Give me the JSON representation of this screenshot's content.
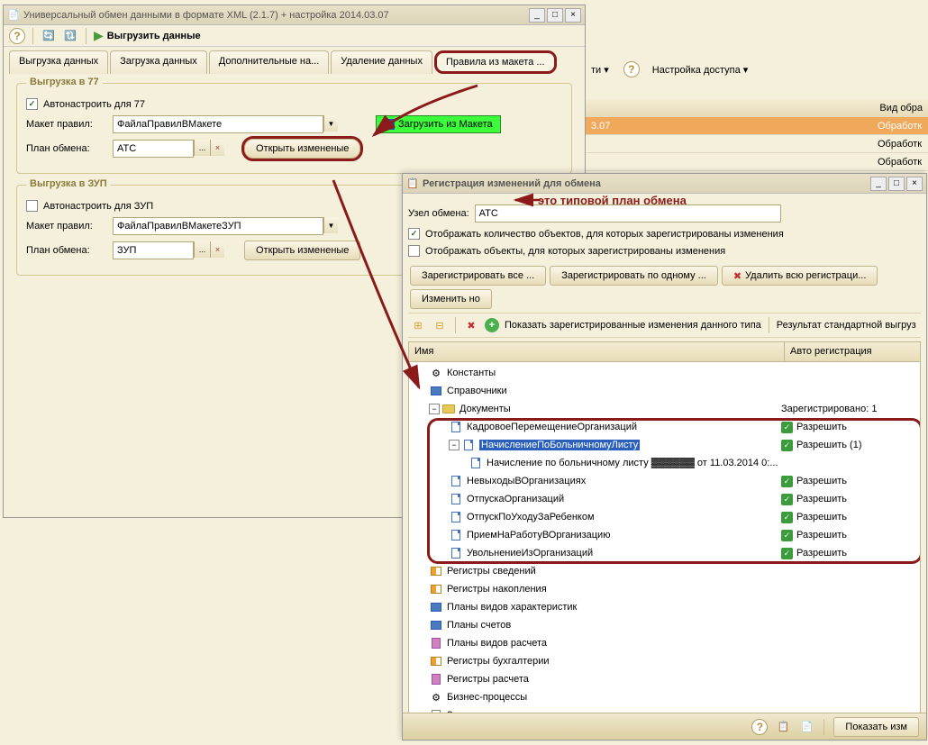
{
  "window1": {
    "title": "Универсальный обмен данными в формате XML (2.1.7) + настройка 2014.03.07",
    "toolbar_action": "Выгрузить данные",
    "tabs": [
      "Выгрузка данных",
      "Загрузка данных",
      "Дополнительные на...",
      "Удаление данных",
      "Правила из макета ..."
    ],
    "group77": {
      "title": "Выгрузка в 77",
      "autotune": "Автонастроить для 77",
      "maket_label": "Макет правил:",
      "maket_value": "ФайлаПравилВМакете",
      "plan_label": "План обмена:",
      "plan_value": "АТС",
      "open_btn": "Открыть измененые",
      "load_btn": "Загрузить из Макета"
    },
    "groupZUP": {
      "title": "Выгрузка в ЗУП",
      "autotune": "Автонастроить для ЗУП",
      "maket_label": "Макет правил:",
      "maket_value": "ФайлаПравилВМакетеЗУП",
      "plan_label": "План обмена:",
      "plan_value": "ЗУП",
      "open_btn": "Открыть измененые"
    }
  },
  "bg": {
    "tab_suffix": "ти ▾",
    "help": "?",
    "access": "Настройка доступа ▾",
    "header_col": "Вид обра",
    "row1": "3.07",
    "col2_text": "Обработк"
  },
  "window2": {
    "title": "Регистрация изменений для обмена",
    "node_label": "Узел обмена:",
    "node_value": "АТС",
    "annotation": "это типовой план обмена",
    "chk1": "Отображать количество объектов, для которых зарегистрированы изменения",
    "chk2": "Отображать объекты, для которых зарегистрированы изменения",
    "btns": [
      "Зарегистрировать все ...",
      "Зарегистрировать по одному ...",
      "Удалить всю регистраци...",
      "Изменить но"
    ],
    "tb3_link1": "Показать зарегистрированные изменения данного типа",
    "tb3_link2": "Результат стандартной выгруз",
    "tree_header": [
      "Имя",
      "Авто регистрация"
    ],
    "tree": [
      {
        "l": 0,
        "icon": "gear",
        "label": "Константы",
        "col2": ""
      },
      {
        "l": 0,
        "icon": "book",
        "label": "Справочники",
        "col2": ""
      },
      {
        "l": 0,
        "icon": "folder",
        "label": "Документы",
        "col2": "Зарегистрировано: 1",
        "exp": "open"
      },
      {
        "l": 1,
        "icon": "doc",
        "label": "КадровоеПеремещениеОрганизаций",
        "col2": "Разрешить",
        "allow": true
      },
      {
        "l": 1,
        "icon": "doc",
        "label": "НачислениеПоБольничномуЛисту",
        "col2": "Разрешить (1)",
        "allow": true,
        "selected": true,
        "exp": "minus"
      },
      {
        "l": 2,
        "icon": "doc",
        "label": "Начисление по больничному листу ▓▓▓▓▓▓ от 11.03.2014 0:...",
        "col2": ""
      },
      {
        "l": 1,
        "icon": "doc",
        "label": "НевыходыВОрганизациях",
        "col2": "Разрешить",
        "allow": true
      },
      {
        "l": 1,
        "icon": "doc",
        "label": "ОтпускаОрганизаций",
        "col2": "Разрешить",
        "allow": true
      },
      {
        "l": 1,
        "icon": "doc",
        "label": "ОтпускПоУходуЗаРебенком",
        "col2": "Разрешить",
        "allow": true
      },
      {
        "l": 1,
        "icon": "doc",
        "label": "ПриемНаРаботуВОрганизацию",
        "col2": "Разрешить",
        "allow": true
      },
      {
        "l": 1,
        "icon": "doc",
        "label": "УвольнениеИзОрганизаций",
        "col2": "Разрешить",
        "allow": true
      },
      {
        "l": 0,
        "icon": "reg",
        "label": "Регистры сведений",
        "col2": ""
      },
      {
        "l": 0,
        "icon": "reg",
        "label": "Регистры накопления",
        "col2": ""
      },
      {
        "l": 0,
        "icon": "book",
        "label": "Планы видов характеристик",
        "col2": ""
      },
      {
        "l": 0,
        "icon": "book",
        "label": "Планы счетов",
        "col2": ""
      },
      {
        "l": 0,
        "icon": "calc",
        "label": "Планы видов расчета",
        "col2": ""
      },
      {
        "l": 0,
        "icon": "reg",
        "label": "Регистры бухгалтерии",
        "col2": ""
      },
      {
        "l": 0,
        "icon": "calc",
        "label": "Регистры расчета",
        "col2": ""
      },
      {
        "l": 0,
        "icon": "gear",
        "label": "Бизнес-процессы",
        "col2": ""
      },
      {
        "l": 0,
        "icon": "task",
        "label": "Задачи",
        "col2": ""
      }
    ],
    "footer_btn": "Показать изм"
  }
}
